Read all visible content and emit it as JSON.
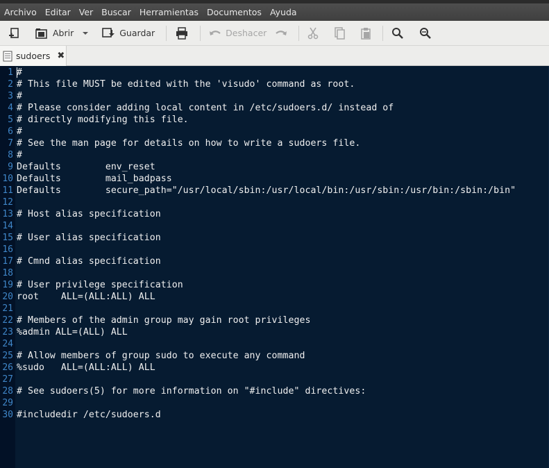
{
  "menu": [
    "Archivo",
    "Editar",
    "Ver",
    "Buscar",
    "Herramientas",
    "Documentos",
    "Ayuda"
  ],
  "toolbar": {
    "open_label": "Abrir",
    "save_label": "Guardar",
    "undo_label": "Deshacer"
  },
  "tab": {
    "title": "sudoers"
  },
  "editor": {
    "lines": [
      "#",
      "# This file MUST be edited with the 'visudo' command as root.",
      "#",
      "# Please consider adding local content in /etc/sudoers.d/ instead of",
      "# directly modifying this file.",
      "#",
      "# See the man page for details on how to write a sudoers file.",
      "#",
      "Defaults        env_reset",
      "Defaults        mail_badpass",
      "Defaults        secure_path=\"/usr/local/sbin:/usr/local/bin:/usr/sbin:/usr/bin:/sbin:/bin\"",
      "",
      "# Host alias specification",
      "",
      "# User alias specification",
      "",
      "# Cmnd alias specification",
      "",
      "# User privilege specification",
      "root    ALL=(ALL:ALL) ALL",
      "",
      "# Members of the admin group may gain root privileges",
      "%admin ALL=(ALL) ALL",
      "",
      "# Allow members of group sudo to execute any command",
      "%sudo   ALL=(ALL:ALL) ALL",
      "",
      "# See sudoers(5) for more information on \"#include\" directives:",
      "",
      "#includedir /etc/sudoers.d"
    ]
  },
  "colors": {
    "editor_bg": "#061b31",
    "gutter_bg": "#021126",
    "line_number": "#3f86c8",
    "text": "#f0f0f0"
  }
}
